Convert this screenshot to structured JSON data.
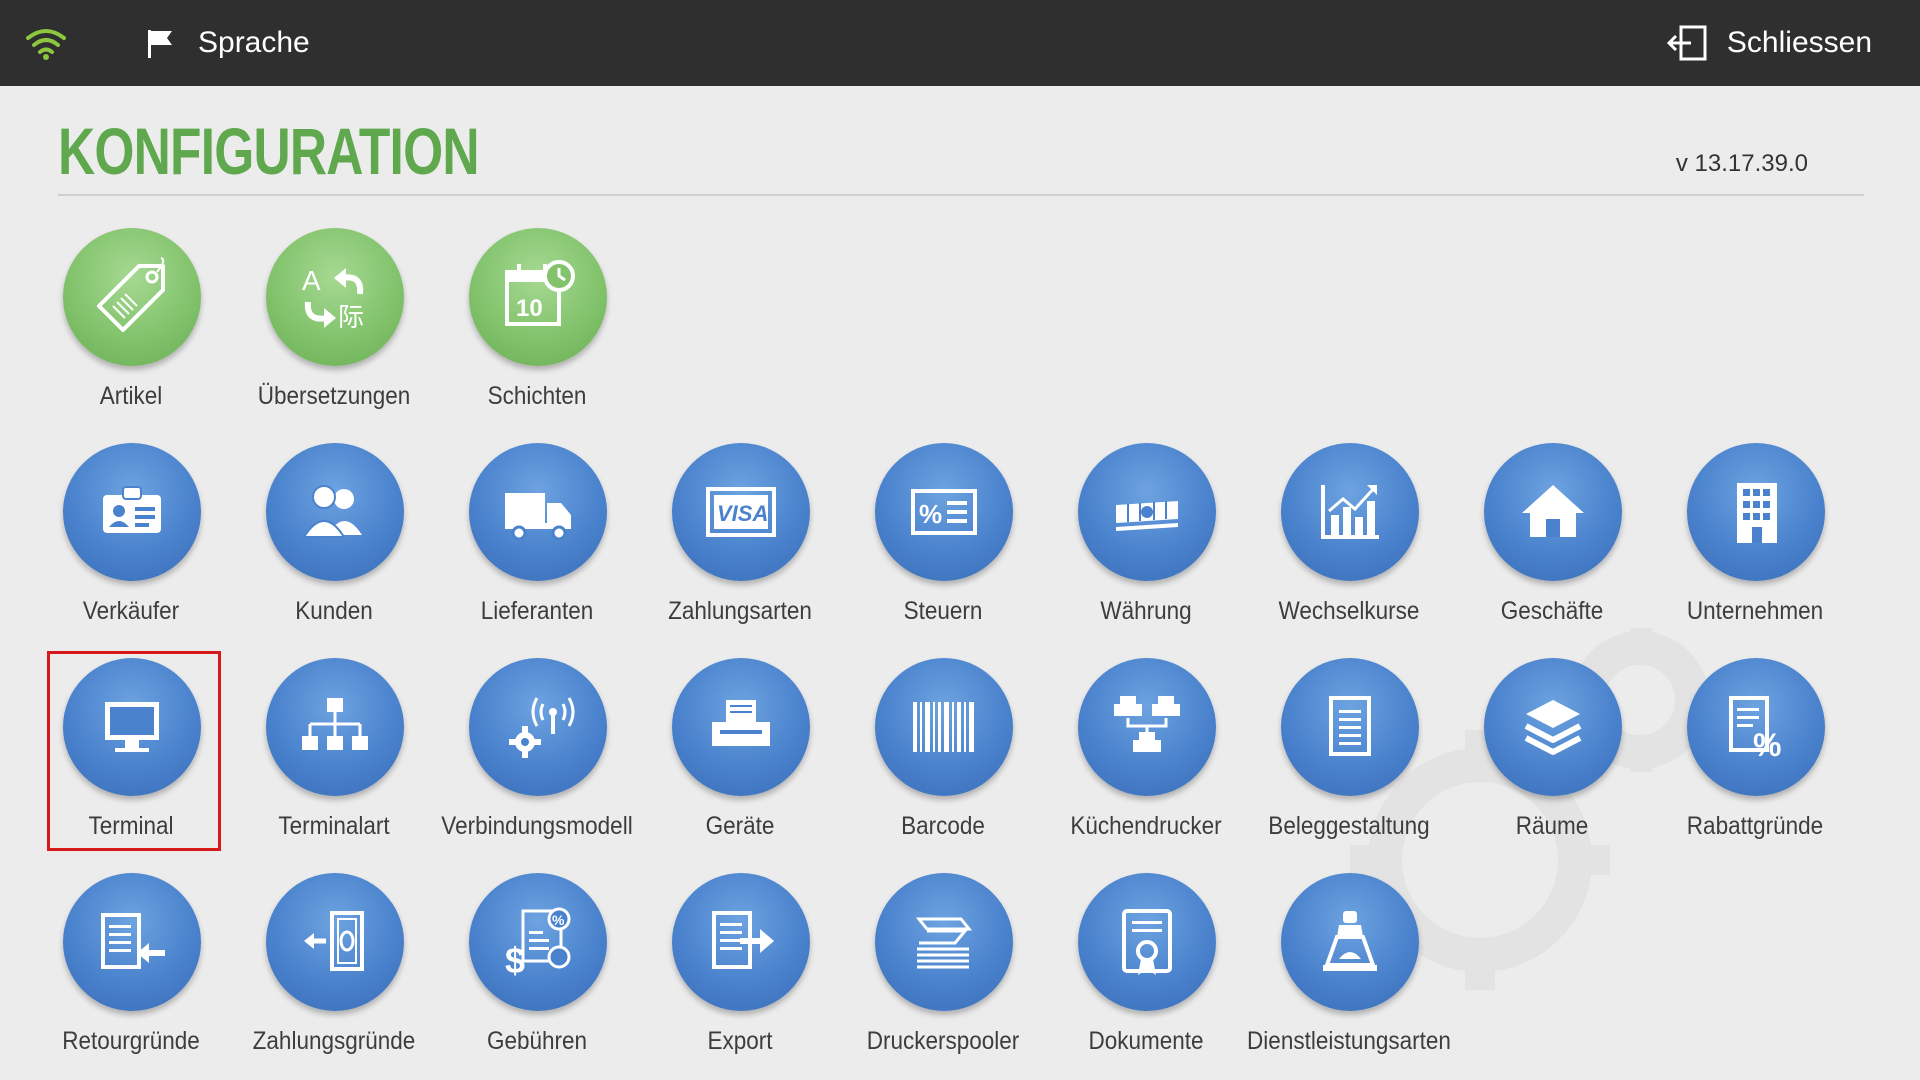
{
  "topbar": {
    "language_label": "Sprache",
    "close_label": "Schliessen",
    "wifi_color": "#8dc63f"
  },
  "header": {
    "title": "KONFIGURATION",
    "version": "v 13.17.39.0"
  },
  "colors": {
    "green_circle": "#82c36c",
    "blue_circle": "#4a82cd",
    "title": "#5fa84e",
    "highlight": "#d7191c"
  },
  "tiles": {
    "artikel": {
      "label": "Artikel",
      "icon": "price-tag-icon"
    },
    "uebersetzungen": {
      "label": "Übersetzungen",
      "icon": "translate-icon"
    },
    "schichten": {
      "label": "Schichten",
      "icon": "calendar-clock-icon"
    },
    "verkaeufer": {
      "label": "Verkäufer",
      "icon": "id-card-icon"
    },
    "kunden": {
      "label": "Kunden",
      "icon": "users-icon"
    },
    "lieferanten": {
      "label": "Lieferanten",
      "icon": "truck-icon"
    },
    "zahlungsarten": {
      "label": "Zahlungsarten",
      "icon": "visa-card-icon"
    },
    "steuern": {
      "label": "Steuern",
      "icon": "percent-icon"
    },
    "waehrung": {
      "label": "Währung",
      "icon": "banknotes-icon"
    },
    "wechselkurse": {
      "label": "Wechselkurse",
      "icon": "chart-icon"
    },
    "geschaefte": {
      "label": "Geschäfte",
      "icon": "house-icon"
    },
    "unternehmen": {
      "label": "Unternehmen",
      "icon": "building-icon"
    },
    "terminal": {
      "label": "Terminal",
      "icon": "monitor-icon"
    },
    "terminalart": {
      "label": "Terminalart",
      "icon": "network-icon"
    },
    "verbindungsmodell": {
      "label": "Verbindungsmodell",
      "icon": "antenna-gear-icon"
    },
    "geraete": {
      "label": "Geräte",
      "icon": "printer-icon"
    },
    "barcode": {
      "label": "Barcode",
      "icon": "barcode-icon"
    },
    "kuechendrucker": {
      "label": "Küchendrucker",
      "icon": "printers-icon"
    },
    "beleggestaltung": {
      "label": "Beleggestaltung",
      "icon": "receipt-icon"
    },
    "raeume": {
      "label": "Räume",
      "icon": "layers-icon"
    },
    "rabattgruende": {
      "label": "Rabattgründe",
      "icon": "discount-doc-icon"
    },
    "retourgruende": {
      "label": "Retourgründe",
      "icon": "return-doc-icon"
    },
    "zahlungsgruende": {
      "label": "Zahlungsgründe",
      "icon": "cash-out-icon"
    },
    "gebuehren": {
      "label": "Gebühren",
      "icon": "fees-icon"
    },
    "export": {
      "label": "Export",
      "icon": "export-icon"
    },
    "druckerspooler": {
      "label": "Druckerspooler",
      "icon": "paper-stack-icon"
    },
    "dokumente": {
      "label": "Dokumente",
      "icon": "certificate-icon"
    },
    "dienstleistungsarten": {
      "label": "Dienstleistungsarten",
      "icon": "service-bell-icon"
    }
  }
}
